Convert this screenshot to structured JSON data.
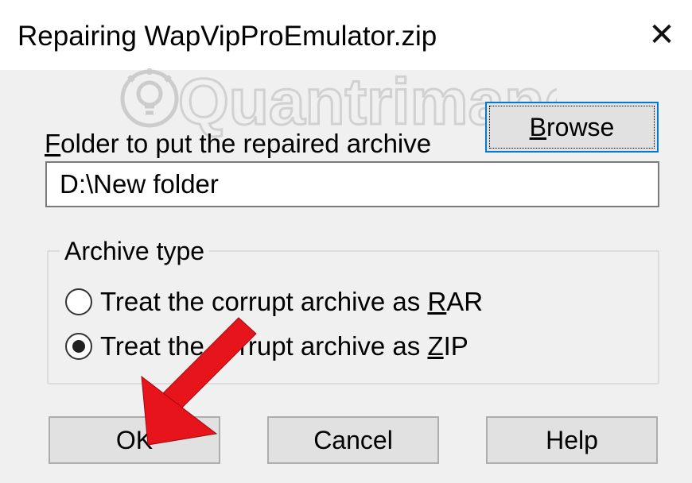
{
  "window": {
    "title": "Repairing WapVipProEmulator.zip",
    "close_glyph": "✕"
  },
  "watermark": {
    "text": "Quantrimang"
  },
  "folder": {
    "label_first": "F",
    "label_rest": "older to put the repaired archive",
    "value": "D:\\New folder",
    "browse_first": "B",
    "browse_rest": "rowse"
  },
  "archive_type": {
    "legend": "Archive type",
    "options": [
      {
        "prefix": "Treat the corrupt archive as ",
        "accel": "R",
        "suffix": "AR",
        "selected": false
      },
      {
        "prefix": "Treat the corrupt archive as ",
        "accel": "Z",
        "suffix": "IP",
        "selected": true
      }
    ]
  },
  "buttons": {
    "ok": "OK",
    "cancel": "Cancel",
    "help": "Help"
  },
  "colors": {
    "arrow": "#e8141c",
    "focus_border": "#0078d7",
    "button_face": "#e1e1e1"
  },
  "icons": {
    "close": "close-icon",
    "lightbulb": "lightbulb-icon",
    "arrow": "pointer-arrow-icon"
  }
}
